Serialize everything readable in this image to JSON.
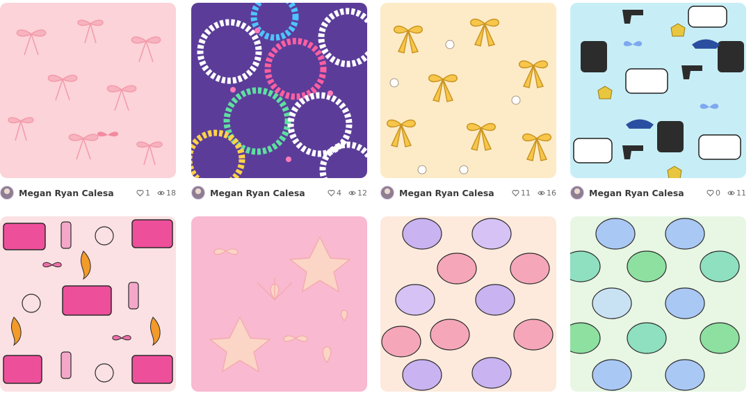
{
  "colors": {
    "text": "#3a3a3a",
    "muted": "#6a6a6a"
  },
  "cards": [
    {
      "pattern": "pink-bows",
      "author": "Megan Ryan Calesa",
      "likes": "1",
      "views": "18"
    },
    {
      "pattern": "bead-bracelets-faith-grace",
      "author": "Megan Ryan Calesa",
      "likes": "4",
      "views": "12"
    },
    {
      "pattern": "yellow-bows-pencils-flowers",
      "author": "Megan Ryan Calesa",
      "likes": "11",
      "views": "16"
    },
    {
      "pattern": "police-badges-cars-vests",
      "author": "Megan Ryan Calesa",
      "likes": "0",
      "views": "11"
    },
    {
      "pattern": "pink-firefighter",
      "author": "",
      "likes": "",
      "views": ""
    },
    {
      "pattern": "pink-seashells-starfish-bows",
      "author": "",
      "likes": "",
      "views": ""
    },
    {
      "pattern": "pastel-pumpkin-buckets",
      "author": "",
      "likes": "",
      "views": ""
    },
    {
      "pattern": "cool-pumpkin-buckets",
      "author": "",
      "likes": "",
      "views": ""
    }
  ]
}
